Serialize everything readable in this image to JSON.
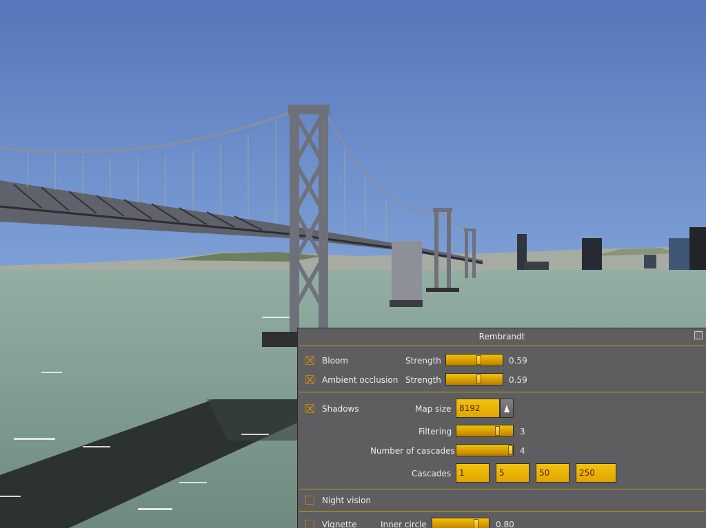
{
  "dialog": {
    "title": "Rembrandt",
    "bloom": {
      "label": "Bloom",
      "checked": true,
      "strength_label": "Strength",
      "strength": 0.59,
      "value_text": "0.59"
    },
    "ambient_occlusion": {
      "label": "Ambient occlusion",
      "checked": true,
      "strength_label": "Strength",
      "strength": 0.59,
      "value_text": "0.59"
    },
    "shadows": {
      "label": "Shadows",
      "checked": true,
      "map_size_label": "Map size",
      "map_size": "8192",
      "filtering_label": "Filtering",
      "filtering": 3,
      "filtering_max": 4,
      "filtering_text": "3",
      "cascades_count_label": "Number of cascades",
      "cascades_count": 4,
      "cascades_count_max": 4,
      "cascades_count_text": "4",
      "cascades_label": "Cascades",
      "cascades": [
        "1",
        "5",
        "50",
        "250"
      ]
    },
    "night_vision": {
      "label": "Night vision",
      "checked": false
    },
    "vignette": {
      "label": "Vignette",
      "checked": false,
      "inner_circle_label": "Inner circle",
      "inner_circle": 0.8,
      "inner_circle_text": "0.80"
    }
  },
  "colors": {
    "sky": "#5a7fc0",
    "water": "#7e9b8f",
    "bridge": "#6d7079",
    "panel": "#5e5e60",
    "accent": "#e8b000"
  }
}
